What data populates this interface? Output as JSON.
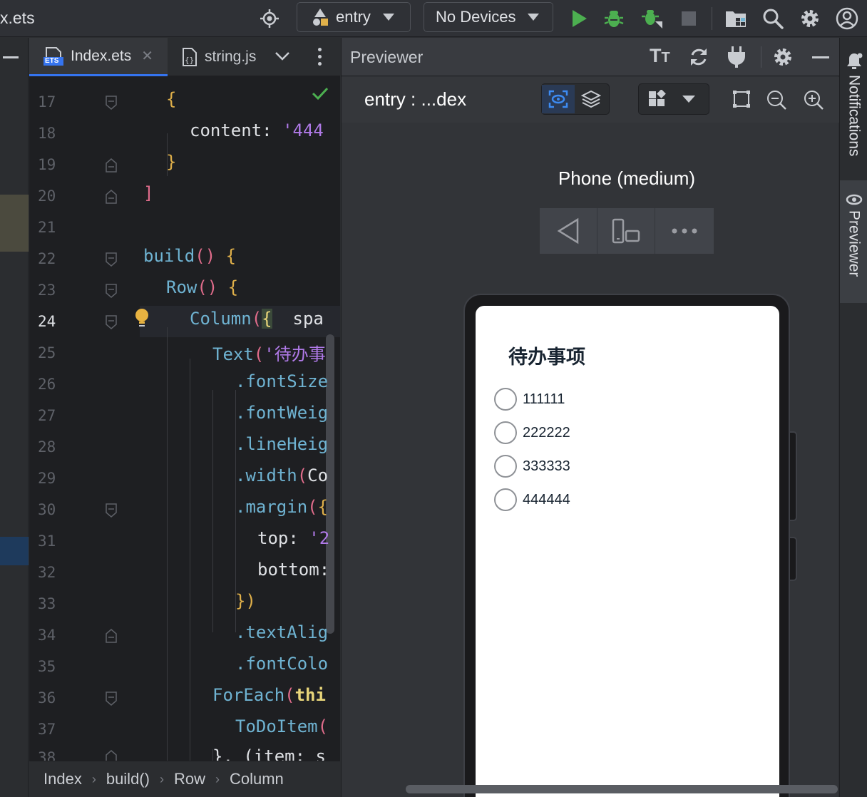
{
  "window": {
    "title": "x.ets"
  },
  "toolbar": {
    "module": "entry",
    "device": "No Devices"
  },
  "editor": {
    "tabs": [
      {
        "label": "Index.ets",
        "badge": "ETS"
      },
      {
        "label": "string.js"
      }
    ],
    "lines": [
      {
        "n": "17",
        "current": false
      },
      {
        "n": "18",
        "current": false
      },
      {
        "n": "19",
        "current": false
      },
      {
        "n": "20",
        "current": false
      },
      {
        "n": "21",
        "current": false
      },
      {
        "n": "22",
        "current": false
      },
      {
        "n": "23",
        "current": false
      },
      {
        "n": "24",
        "current": true
      },
      {
        "n": "25",
        "current": false
      },
      {
        "n": "26",
        "current": false
      },
      {
        "n": "27",
        "current": false
      },
      {
        "n": "28",
        "current": false
      },
      {
        "n": "29",
        "current": false
      },
      {
        "n": "30",
        "current": false
      },
      {
        "n": "31",
        "current": false
      },
      {
        "n": "32",
        "current": false
      },
      {
        "n": "33",
        "current": false
      },
      {
        "n": "34",
        "current": false
      },
      {
        "n": "35",
        "current": false
      },
      {
        "n": "36",
        "current": false
      },
      {
        "n": "37",
        "current": false
      },
      {
        "n": "38",
        "current": false
      }
    ],
    "code": {
      "l17": "{",
      "l18_key": "content",
      "l18_val": "'444",
      "l19": "}",
      "l20": "]",
      "l22_fn": "build",
      "l23_fn": "Row",
      "l24_fn": "Column",
      "l24_rest": "spa",
      "l25_fn": "Text",
      "l25_str": "'待办事",
      "l26": ".fontSize",
      "l27": ".fontWeig",
      "l28": ".lineHeig",
      "l29_fn": ".width",
      "l29_arg": "Co",
      "l30_fn": ".margin",
      "l31_key": "top",
      "l31_val": "'2",
      "l32_key": "bottom",
      "l33": "})",
      "l34": ".textAlig",
      "l35": ".fontColo",
      "l36_fn": "ForEach",
      "l36_arg": "thi",
      "l37_fn": "ToDoItem",
      "l38": "}, (item: s"
    },
    "breadcrumb": [
      "Index",
      "build()",
      "Row",
      "Column"
    ]
  },
  "previewer": {
    "title": "Previewer",
    "entry_path": "entry : ...dex",
    "device_name": "Phone (medium)",
    "app": {
      "title": "待办事项",
      "items": [
        "111111",
        "222222",
        "333333",
        "444444"
      ]
    }
  },
  "right_strip": {
    "notifications": "Notifications",
    "previewer": "Previewer"
  }
}
